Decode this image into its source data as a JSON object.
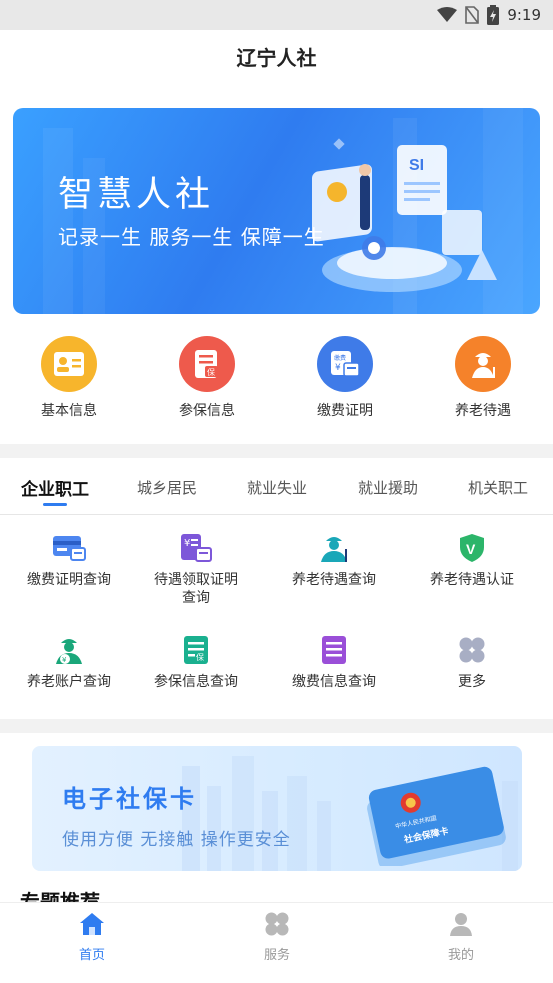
{
  "status_bar": {
    "time": "9:19"
  },
  "header": {
    "title": "辽宁人社"
  },
  "banner": {
    "title": "智慧人社",
    "subtitle": "记录一生  服务一生  保障一生"
  },
  "quick_links": [
    {
      "label": "基本信息",
      "icon": "id-card-icon",
      "color": "#f7b52c"
    },
    {
      "label": "参保信息",
      "icon": "insurance-doc-icon",
      "color": "#ee5a4c"
    },
    {
      "label": "缴费证明",
      "icon": "payment-cert-icon",
      "color": "#3f7be8"
    },
    {
      "label": "养老待遇",
      "icon": "elderly-icon",
      "color": "#f5822a"
    }
  ],
  "tabs": [
    {
      "label": "企业职工",
      "active": true
    },
    {
      "label": "城乡居民"
    },
    {
      "label": "就业失业"
    },
    {
      "label": "就业援助"
    },
    {
      "label": "机关职工"
    }
  ],
  "services": [
    {
      "label": "缴费证明查询",
      "icon": "payment-card-icon"
    },
    {
      "label": "待遇领取证明",
      "label2": "查询",
      "icon": "benefit-cert-icon"
    },
    {
      "label": "养老待遇查询",
      "icon": "elderly-icon"
    },
    {
      "label": "养老待遇认证",
      "icon": "shield-v-icon"
    },
    {
      "label": "养老账户查询",
      "icon": "account-icon"
    },
    {
      "label": "参保信息查询",
      "icon": "insurance-doc-icon"
    },
    {
      "label": "缴费信息查询",
      "icon": "payment-doc-icon"
    },
    {
      "label": "更多",
      "icon": "more-grid-icon"
    }
  ],
  "card_banner": {
    "title": "电子社保卡",
    "subtitle": "使用方便  无接触  操作更安全",
    "card_text": "社会保障卡",
    "card_country": "中华人民共和国"
  },
  "section": {
    "title": "专题推荐"
  },
  "bottom_nav": [
    {
      "label": "首页",
      "icon": "home-icon",
      "active": true
    },
    {
      "label": "服务",
      "icon": "grid-icon"
    },
    {
      "label": "我的",
      "icon": "user-icon"
    }
  ],
  "colors": {
    "accent": "#2f7cf0"
  }
}
